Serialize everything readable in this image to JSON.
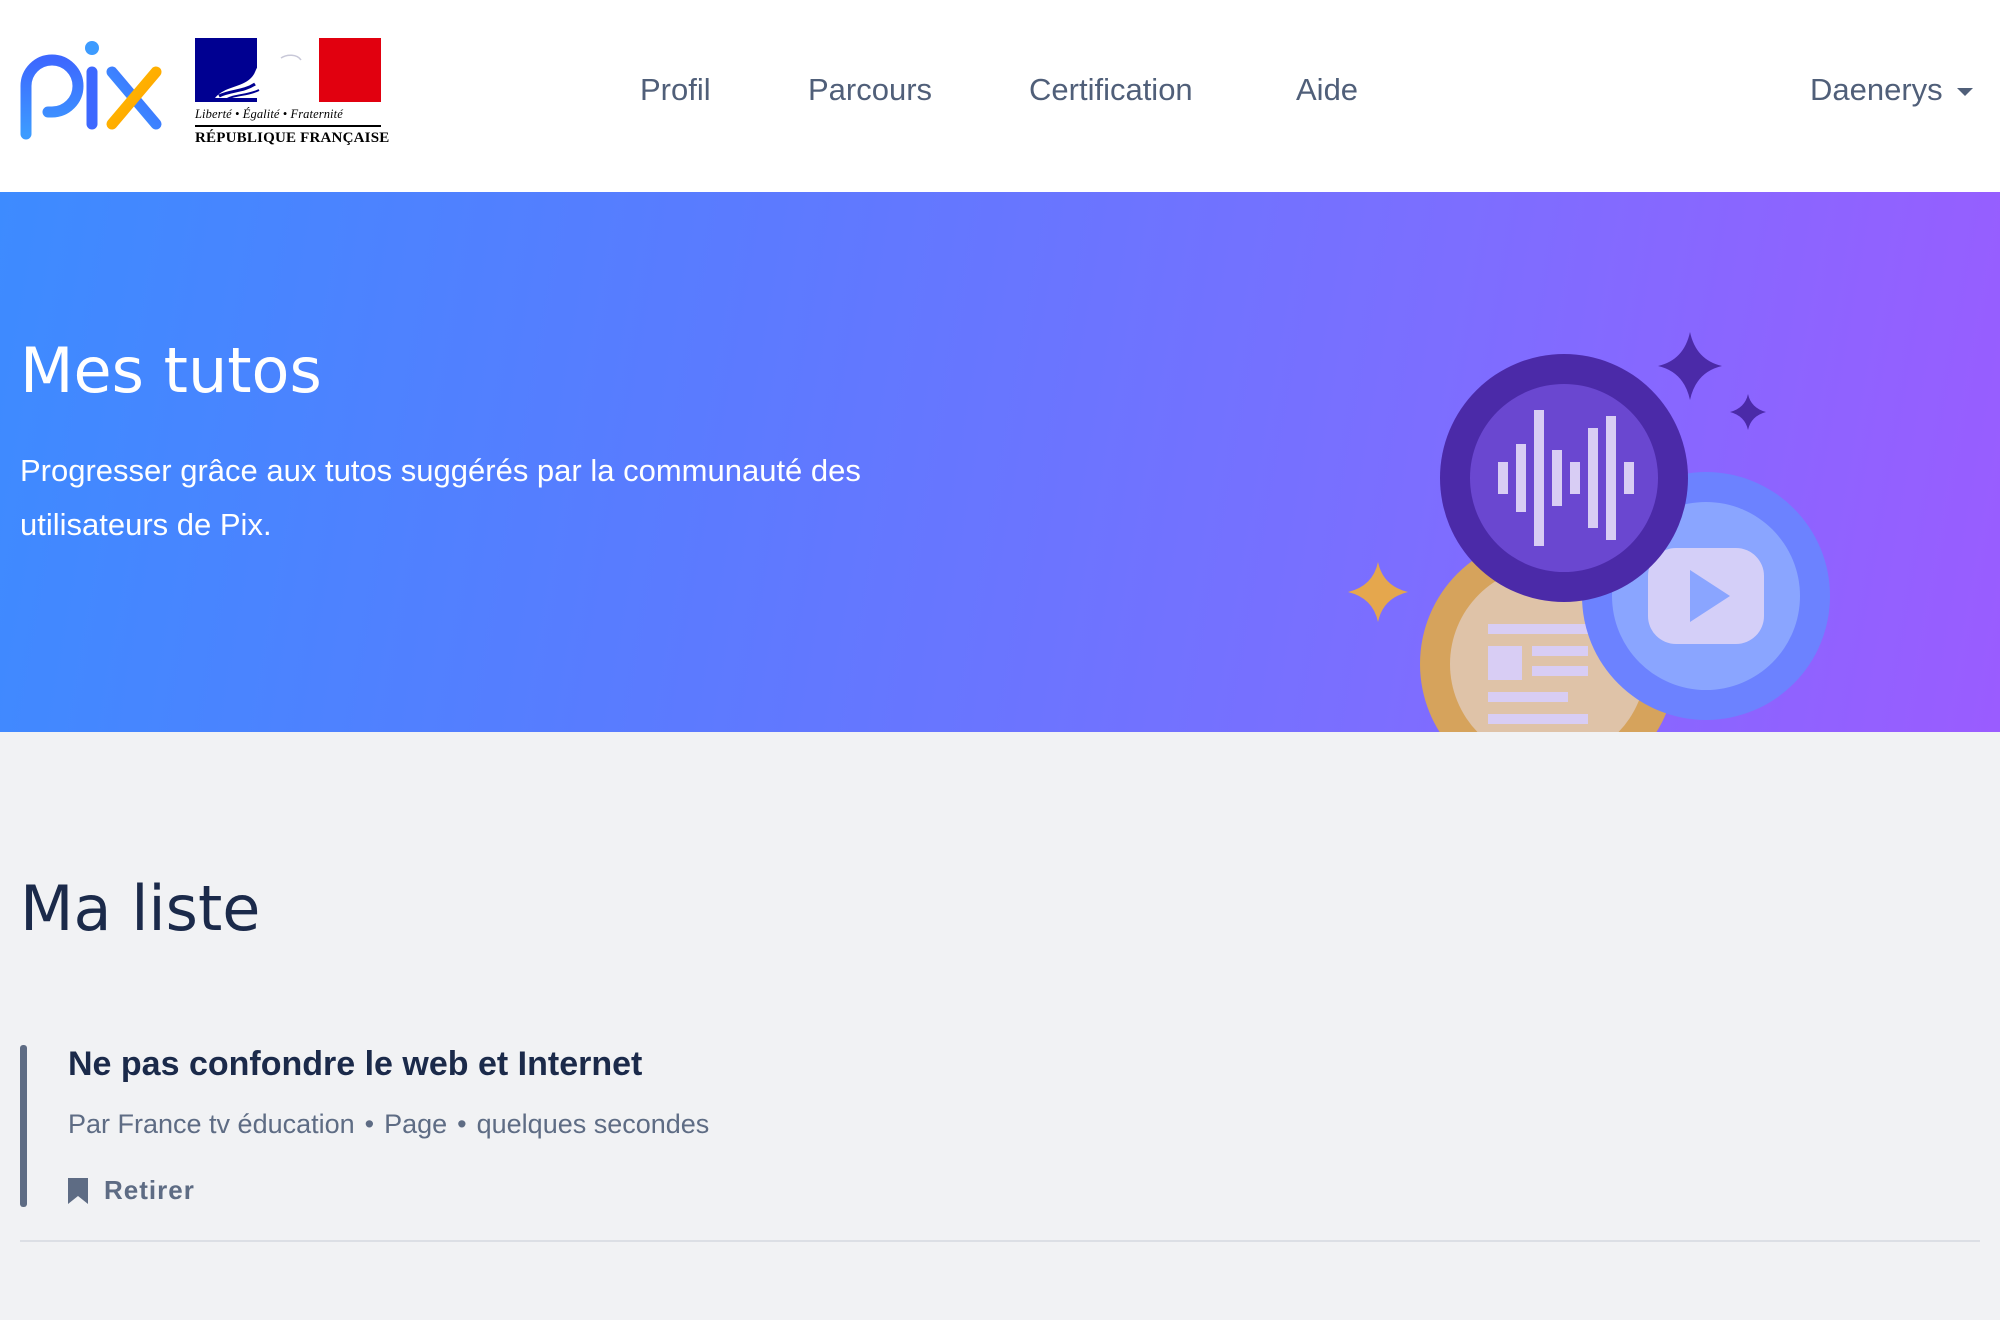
{
  "header": {
    "logo_alt": "pix",
    "marianne": {
      "motto": "Liberté • Égalité • Fraternité",
      "republic": "RÉPUBLIQUE FRANÇAISE"
    },
    "nav": [
      {
        "label": "Profil"
      },
      {
        "label": "Parcours"
      },
      {
        "label": "Certification"
      },
      {
        "label": "Aide"
      }
    ],
    "user": {
      "name": "Daenerys"
    }
  },
  "hero": {
    "title": "Mes tutos",
    "subtitle": "Progresser grâce aux tutos suggérés par la communauté des utilisateurs de Pix."
  },
  "main": {
    "section_title": "Ma liste",
    "tutorials": [
      {
        "title": "Ne pas confondre le web et Internet",
        "source": "Par France tv éducation",
        "format": "Page",
        "duration": "quelques secondes",
        "action_label": "Retirer"
      }
    ]
  },
  "colors": {
    "hero_gradient_start": "#3d8bff",
    "hero_gradient_end": "#9a5cff",
    "text_dark": "#1b2a4a",
    "text_muted": "#5e6c84"
  }
}
